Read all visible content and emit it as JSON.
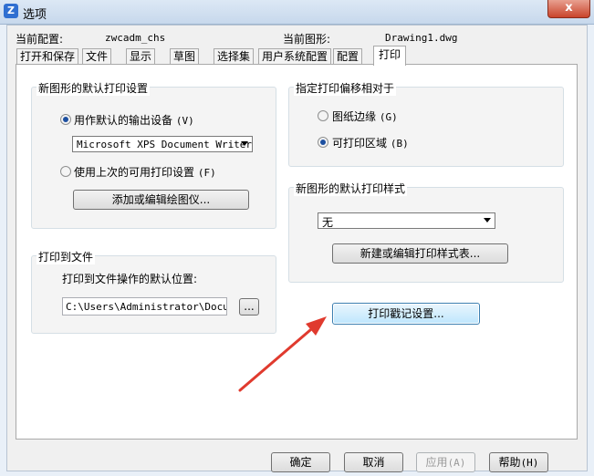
{
  "window": {
    "title": "选项",
    "close_label": "x"
  },
  "header": {
    "config_label": "当前配置:",
    "config_value": "zwcadm_chs",
    "drawing_label": "当前图形:",
    "drawing_value": "Drawing1.dwg"
  },
  "tabs": [
    "打开和保存",
    "文件",
    "显示",
    "草图",
    "选择集",
    "用户系统配置",
    "配置",
    "打印"
  ],
  "active_tab": "打印",
  "default_plot": {
    "title": "新图形的默认打印设置",
    "opt_default_device": "用作默认的输出设备",
    "opt_default_device_key": "(V)",
    "device_value": "Microsoft XPS Document Writer",
    "opt_last_used": "使用上次的可用打印设置",
    "opt_last_used_key": "(F)",
    "add_edit_plotter_button": "添加或编辑绘图仪..."
  },
  "plot_to_file": {
    "title": "打印到文件",
    "location_label": "打印到文件操作的默认位置:",
    "location_value": "C:\\Users\\Administrator\\Docume",
    "browse_button": "..."
  },
  "plot_offset": {
    "title": "指定打印偏移相对于",
    "opt_paper_margin": "图纸边缘",
    "opt_paper_margin_key": "(G)",
    "opt_printable_area": "可打印区域",
    "opt_printable_area_key": "(B)"
  },
  "default_plot_style": {
    "title": "新图形的默认打印样式",
    "style_value": "无",
    "edit_style_table_button": "新建或编辑打印样式表..."
  },
  "plot_stamp_button": "打印戳记设置...",
  "footer": {
    "ok": "确定",
    "cancel": "取消",
    "apply": "应用",
    "apply_key": "(A)",
    "help": "帮助",
    "help_key": "(H)"
  },
  "annotation": {
    "arrow_color": "#e03a2e"
  }
}
